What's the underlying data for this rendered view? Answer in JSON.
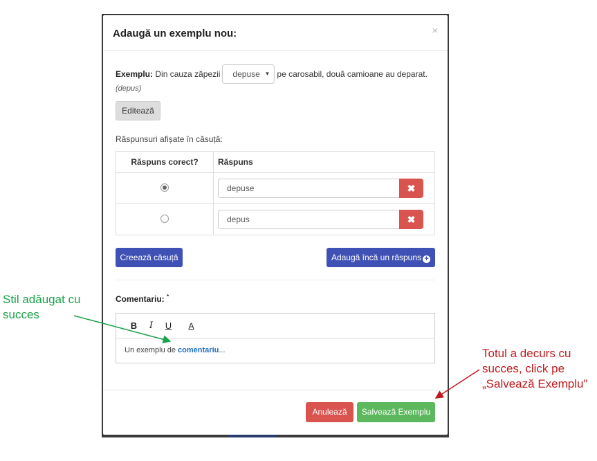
{
  "modal": {
    "title": "Adaugă un exemplu nou:",
    "close_symbol": "×"
  },
  "example": {
    "label": "Exemplu:",
    "text_before": "Din cauza zăpezii",
    "select_value": "depuse",
    "text_after": "pe carosabil, două camioane au deparat.",
    "answer_hint": "(depus)",
    "edit_button": "Editează"
  },
  "answers_section": {
    "label": "Răspunsuri afișate în căsuță:",
    "columns": [
      "Răspuns corect?",
      "Răspuns"
    ],
    "rows": [
      {
        "correct": true,
        "value": "depuse"
      },
      {
        "correct": false,
        "value": "depus"
      }
    ],
    "delete_symbol": "✖",
    "create_button": "Creează căsuță",
    "add_answer_button": "Adaugă încă un răspuns"
  },
  "comment": {
    "label": "Comentariu:",
    "required_mark": "*",
    "toolbar": {
      "bold": "B",
      "italic": "I",
      "underline": "U",
      "color": "A"
    },
    "text_before": "Un exemplu de ",
    "text_bold": "comentariu",
    "text_after": "..."
  },
  "footer": {
    "cancel_button": "Anulează",
    "save_button": "Salvează Exemplu"
  },
  "annotations": {
    "green_line1": "Stil adăugat cu",
    "green_line2": "succes",
    "red_line1": "Totul a decurs cu",
    "red_line2": "succes, click pe",
    "red_line3": "„Salvează Exemplu”"
  },
  "colors": {
    "primary": "#3f51b5",
    "danger": "#d9534f",
    "success": "#5cb85c",
    "annotation_green": "#1aa34a",
    "annotation_red": "#c0181c"
  }
}
